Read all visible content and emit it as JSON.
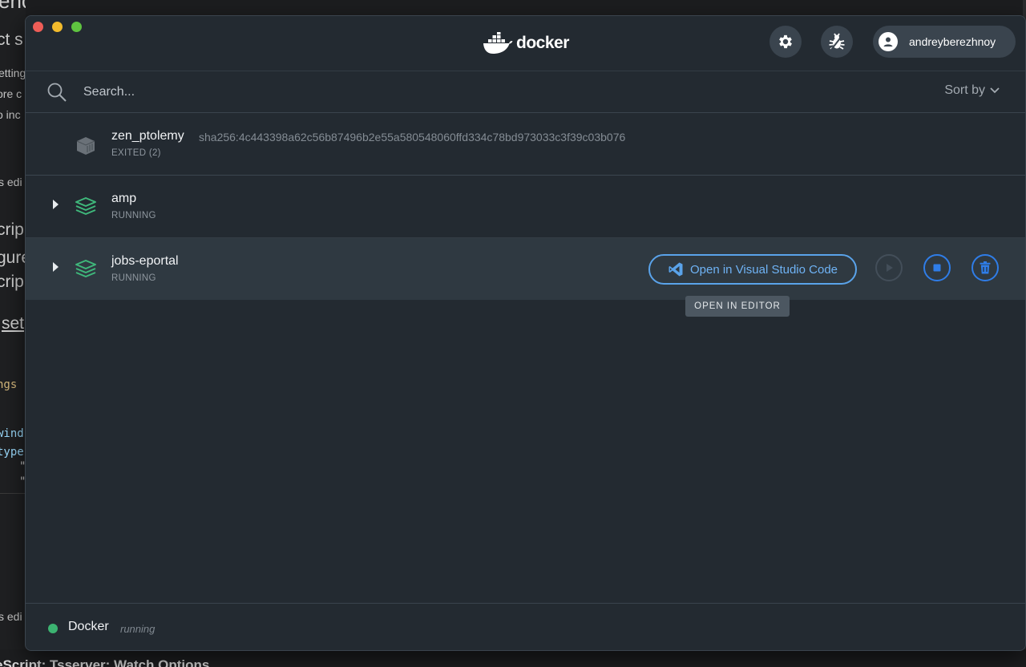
{
  "background": {
    "fragments": [
      "ench",
      "ct s",
      "etting",
      "ore c",
      "o inc",
      "s edi",
      "crip",
      "gure",
      "crip",
      "set",
      "ngs",
      "wind",
      "type",
      "\"",
      "\"",
      "s edi"
    ],
    "bottom_text": "eScript: Tsserver: Watch Options"
  },
  "window": {
    "logo_text": "docker",
    "user": {
      "name": "andreyberezhnoy"
    },
    "icons": {
      "settings": "gear-icon",
      "troubleshoot": "bug-icon",
      "avatar": "user-icon"
    }
  },
  "search": {
    "placeholder": "Search...",
    "value": "",
    "sort_label": "Sort by"
  },
  "containers": [
    {
      "name": "zen_ptolemy",
      "hash": "sha256:4c443398a62c56b87496b2e55a580548060ffd334c78bd973033c3f39c03b076",
      "status": "EXITED (2)"
    },
    {
      "name": "amp",
      "status": "RUNNING"
    },
    {
      "name": "jobs-eportal",
      "status": "RUNNING"
    }
  ],
  "actions": {
    "open_vscode_label": "Open in Visual Studio Code",
    "tooltip": "OPEN IN EDITOR"
  },
  "footer": {
    "app": "Docker",
    "status": "running"
  },
  "colors": {
    "accent": "#2f7de8",
    "running_green": "#3cb371",
    "window_bg": "#232a31"
  }
}
